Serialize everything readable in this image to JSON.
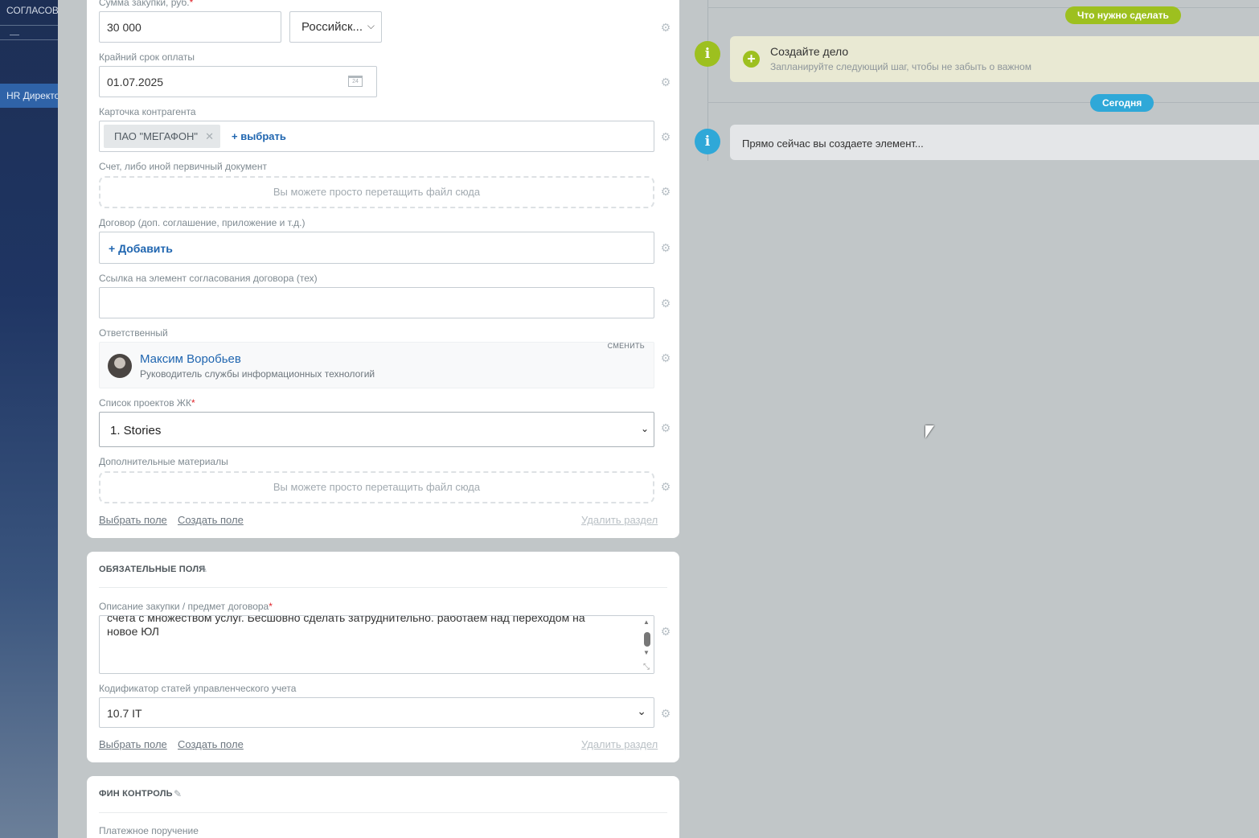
{
  "sidebar": {
    "top_label": "СОГЛАСОВА",
    "active_item": "HR Директо"
  },
  "form": {
    "amount_label": "Сумма закупки, руб.",
    "amount_value": "30 000",
    "currency_value": "Российск...",
    "deadline_label": "Крайний срок оплаты",
    "deadline_value": "01.07.2025",
    "counterparty_label": "Карточка контрагента",
    "counterparty_tag": "ПАО \"МЕГАФОН\"",
    "counterparty_select": "+ выбрать",
    "invoice_label": "Счет, либо иной первичный документ",
    "dropzone_text": "Вы можете просто перетащить файл сюда",
    "contract_label": "Договор (доп. соглашение, приложение и т.д.)",
    "contract_add": "+ Добавить",
    "link_label": "Ссылка на элемент согласования договора (тех)",
    "link_value": "",
    "responsible_label": "Ответственный",
    "responsible_change": "сменить",
    "responsible_name": "Максим Воробьев",
    "responsible_position": "Руководитель службы информационных технологий",
    "projects_label": "Список проектов ЖК",
    "projects_value": "1. Stories",
    "extra_label": "Дополнительные материалы",
    "extra_dropzone": "Вы можете просто перетащить файл сюда",
    "select_field": "Выбрать поле",
    "create_field": "Создать поле",
    "delete_section": "Удалить раздел"
  },
  "required_section": {
    "title": "ОБЯЗАТЕЛЬНЫЕ ПОЛЯ",
    "description_label": "Описание закупки / предмет договора",
    "description_line1": "счета с множеством услуг. Бесшовно сделать затруднительно. работаем над переходом на",
    "description_line2": "новое ЮЛ",
    "codifier_label": "Кодификатор статей управленческого учета",
    "codifier_value": "10.7 IT",
    "select_field": "Выбрать поле",
    "create_field": "Создать поле",
    "delete_section": "Удалить раздел"
  },
  "fin_section": {
    "title": "ФИН КОНТРОЛЬ",
    "payment_label": "Платежное поручение"
  },
  "timeline": {
    "todo_badge": "Что нужно сделать",
    "create_task_title": "Создайте дело",
    "create_task_subtitle": "Запланируйте следующий шаг, чтобы не забыть о важном",
    "today_badge": "Сегодня",
    "creating_text": "Прямо сейчас вы создаете элемент...",
    "colors": {
      "green": "#9dc01f",
      "blue": "#2fa8d8"
    }
  }
}
